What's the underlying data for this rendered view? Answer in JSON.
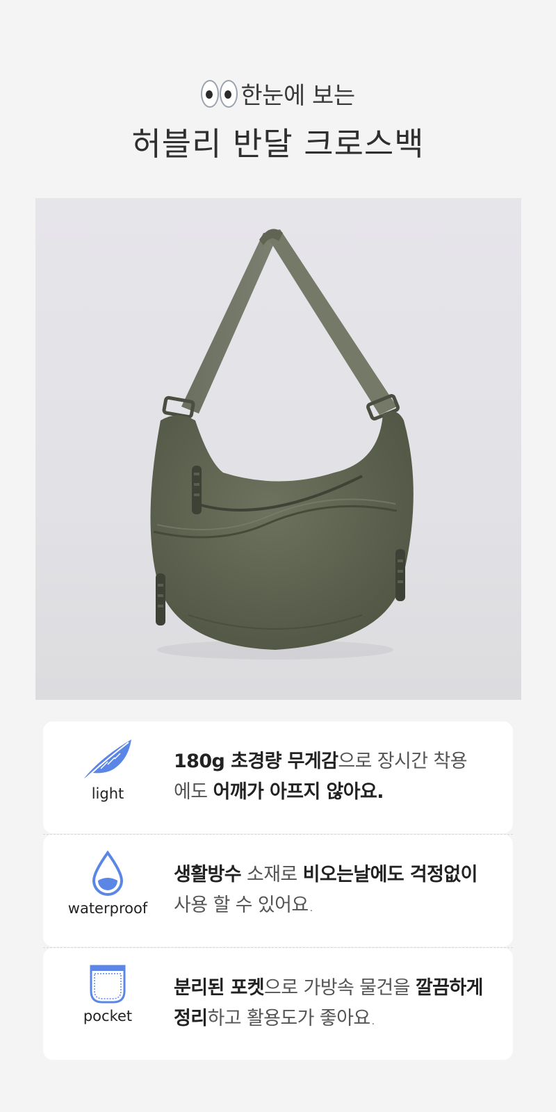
{
  "header": {
    "subtitle": "한눈에 보는",
    "title": "허블리 반달 크로스백"
  },
  "colors": {
    "icon_blue": "#5b86e5",
    "bag_olive": "#5e6350",
    "card_bg": "#ffffff",
    "page_bg": "#f4f4f4"
  },
  "features": [
    {
      "icon": "feather-icon",
      "label": "light",
      "line1": [
        {
          "text": "180g 초경량 무게감",
          "bold": true
        },
        {
          "text": "으로 장시간 착용",
          "bold": false
        }
      ],
      "line2": [
        {
          "text": "에도 ",
          "bold": false
        },
        {
          "text": "어깨가 아프지 않아요.",
          "bold": true
        }
      ]
    },
    {
      "icon": "water-drop-icon",
      "label": "waterproof",
      "line1": [
        {
          "text": "생활방수",
          "bold": true
        },
        {
          "text": " 소재로 ",
          "bold": false
        },
        {
          "text": "비오는날에도 걱정없이",
          "bold": true
        }
      ],
      "line2": [
        {
          "text": "사용 할 수 있어요.",
          "bold": false
        }
      ]
    },
    {
      "icon": "pocket-icon",
      "label": "pocket",
      "line1": [
        {
          "text": "분리된 포켓",
          "bold": true
        },
        {
          "text": "으로 가방속 물건을 ",
          "bold": false
        },
        {
          "text": "깔끔하게",
          "bold": true
        }
      ],
      "line2": [
        {
          "text": "정리",
          "bold": true
        },
        {
          "text": "하고 활용도가 좋아요.",
          "bold": false
        }
      ]
    }
  ]
}
